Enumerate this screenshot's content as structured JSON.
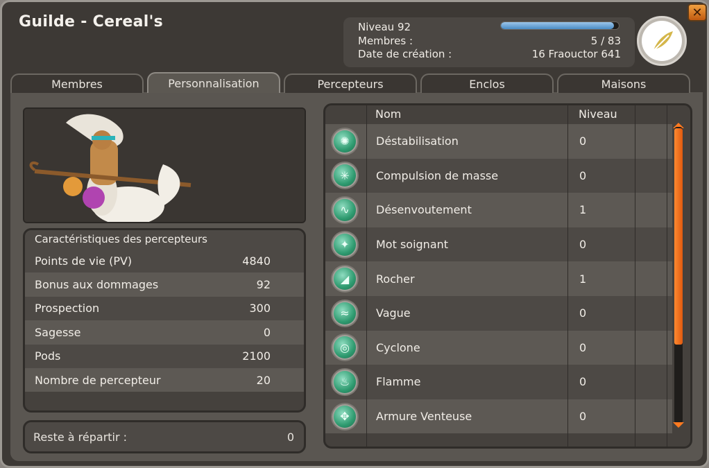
{
  "window": {
    "title": "Guilde - Cereal's",
    "close_label": "✕"
  },
  "header": {
    "level_label": "Niveau 92",
    "members_label": "Membres :",
    "members_value": "5 / 83",
    "creation_label": "Date de création :",
    "creation_value": "16 Fraouctor 641",
    "xp_progress": 0.96
  },
  "tabs": [
    {
      "label": "Membres",
      "active": false
    },
    {
      "label": "Personnalisation",
      "active": true
    },
    {
      "label": "Percepteurs",
      "active": false
    },
    {
      "label": "Enclos",
      "active": false
    },
    {
      "label": "Maisons",
      "active": false
    }
  ],
  "stats": {
    "title": "Caractéristiques des percepteurs",
    "rows": [
      {
        "label": "Points de vie (PV)",
        "value": "4840"
      },
      {
        "label": "Bonus aux dommages",
        "value": "92"
      },
      {
        "label": "Prospection",
        "value": "300"
      },
      {
        "label": "Sagesse",
        "value": "0"
      },
      {
        "label": "Pods",
        "value": "2100"
      },
      {
        "label": "Nombre de percepteur",
        "value": "20"
      }
    ]
  },
  "remaining": {
    "label": "Reste à répartir :",
    "value": "0"
  },
  "spells": {
    "col_name": "Nom",
    "col_level": "Niveau",
    "rows": [
      {
        "name": "Déstabilisation",
        "level": "0",
        "icon": "destabilisation-icon"
      },
      {
        "name": "Compulsion de masse",
        "level": "0",
        "icon": "compulsion-icon"
      },
      {
        "name": "Désenvoutement",
        "level": "1",
        "icon": "desenvoutement-icon"
      },
      {
        "name": "Mot soignant",
        "level": "0",
        "icon": "mot-soignant-icon"
      },
      {
        "name": "Rocher",
        "level": "1",
        "icon": "rocher-icon"
      },
      {
        "name": "Vague",
        "level": "0",
        "icon": "vague-icon"
      },
      {
        "name": "Cyclone",
        "level": "0",
        "icon": "cyclone-icon"
      },
      {
        "name": "Flamme",
        "level": "0",
        "icon": "flamme-icon"
      },
      {
        "name": "Armure Venteuse",
        "level": "0",
        "icon": "armure-venteuse-icon"
      }
    ]
  },
  "colors": {
    "accent": "#ff7a20",
    "xp_bar": "#4a8bc4",
    "spell_icon": "#2f9b70"
  }
}
